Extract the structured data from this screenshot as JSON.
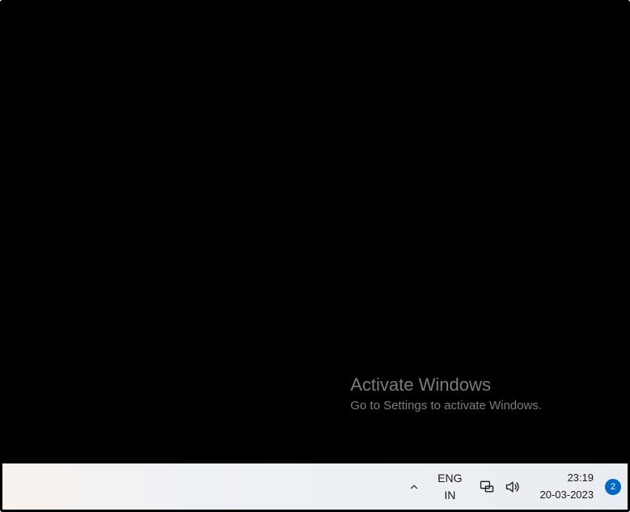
{
  "watermark": {
    "title": "Activate Windows",
    "subtitle": "Go to Settings to activate Windows."
  },
  "taskbar": {
    "language": {
      "lang": "ENG",
      "region": "IN"
    },
    "clock": {
      "time": "23:19",
      "date": "20-03-2023"
    },
    "notifications": {
      "count": "2"
    }
  }
}
